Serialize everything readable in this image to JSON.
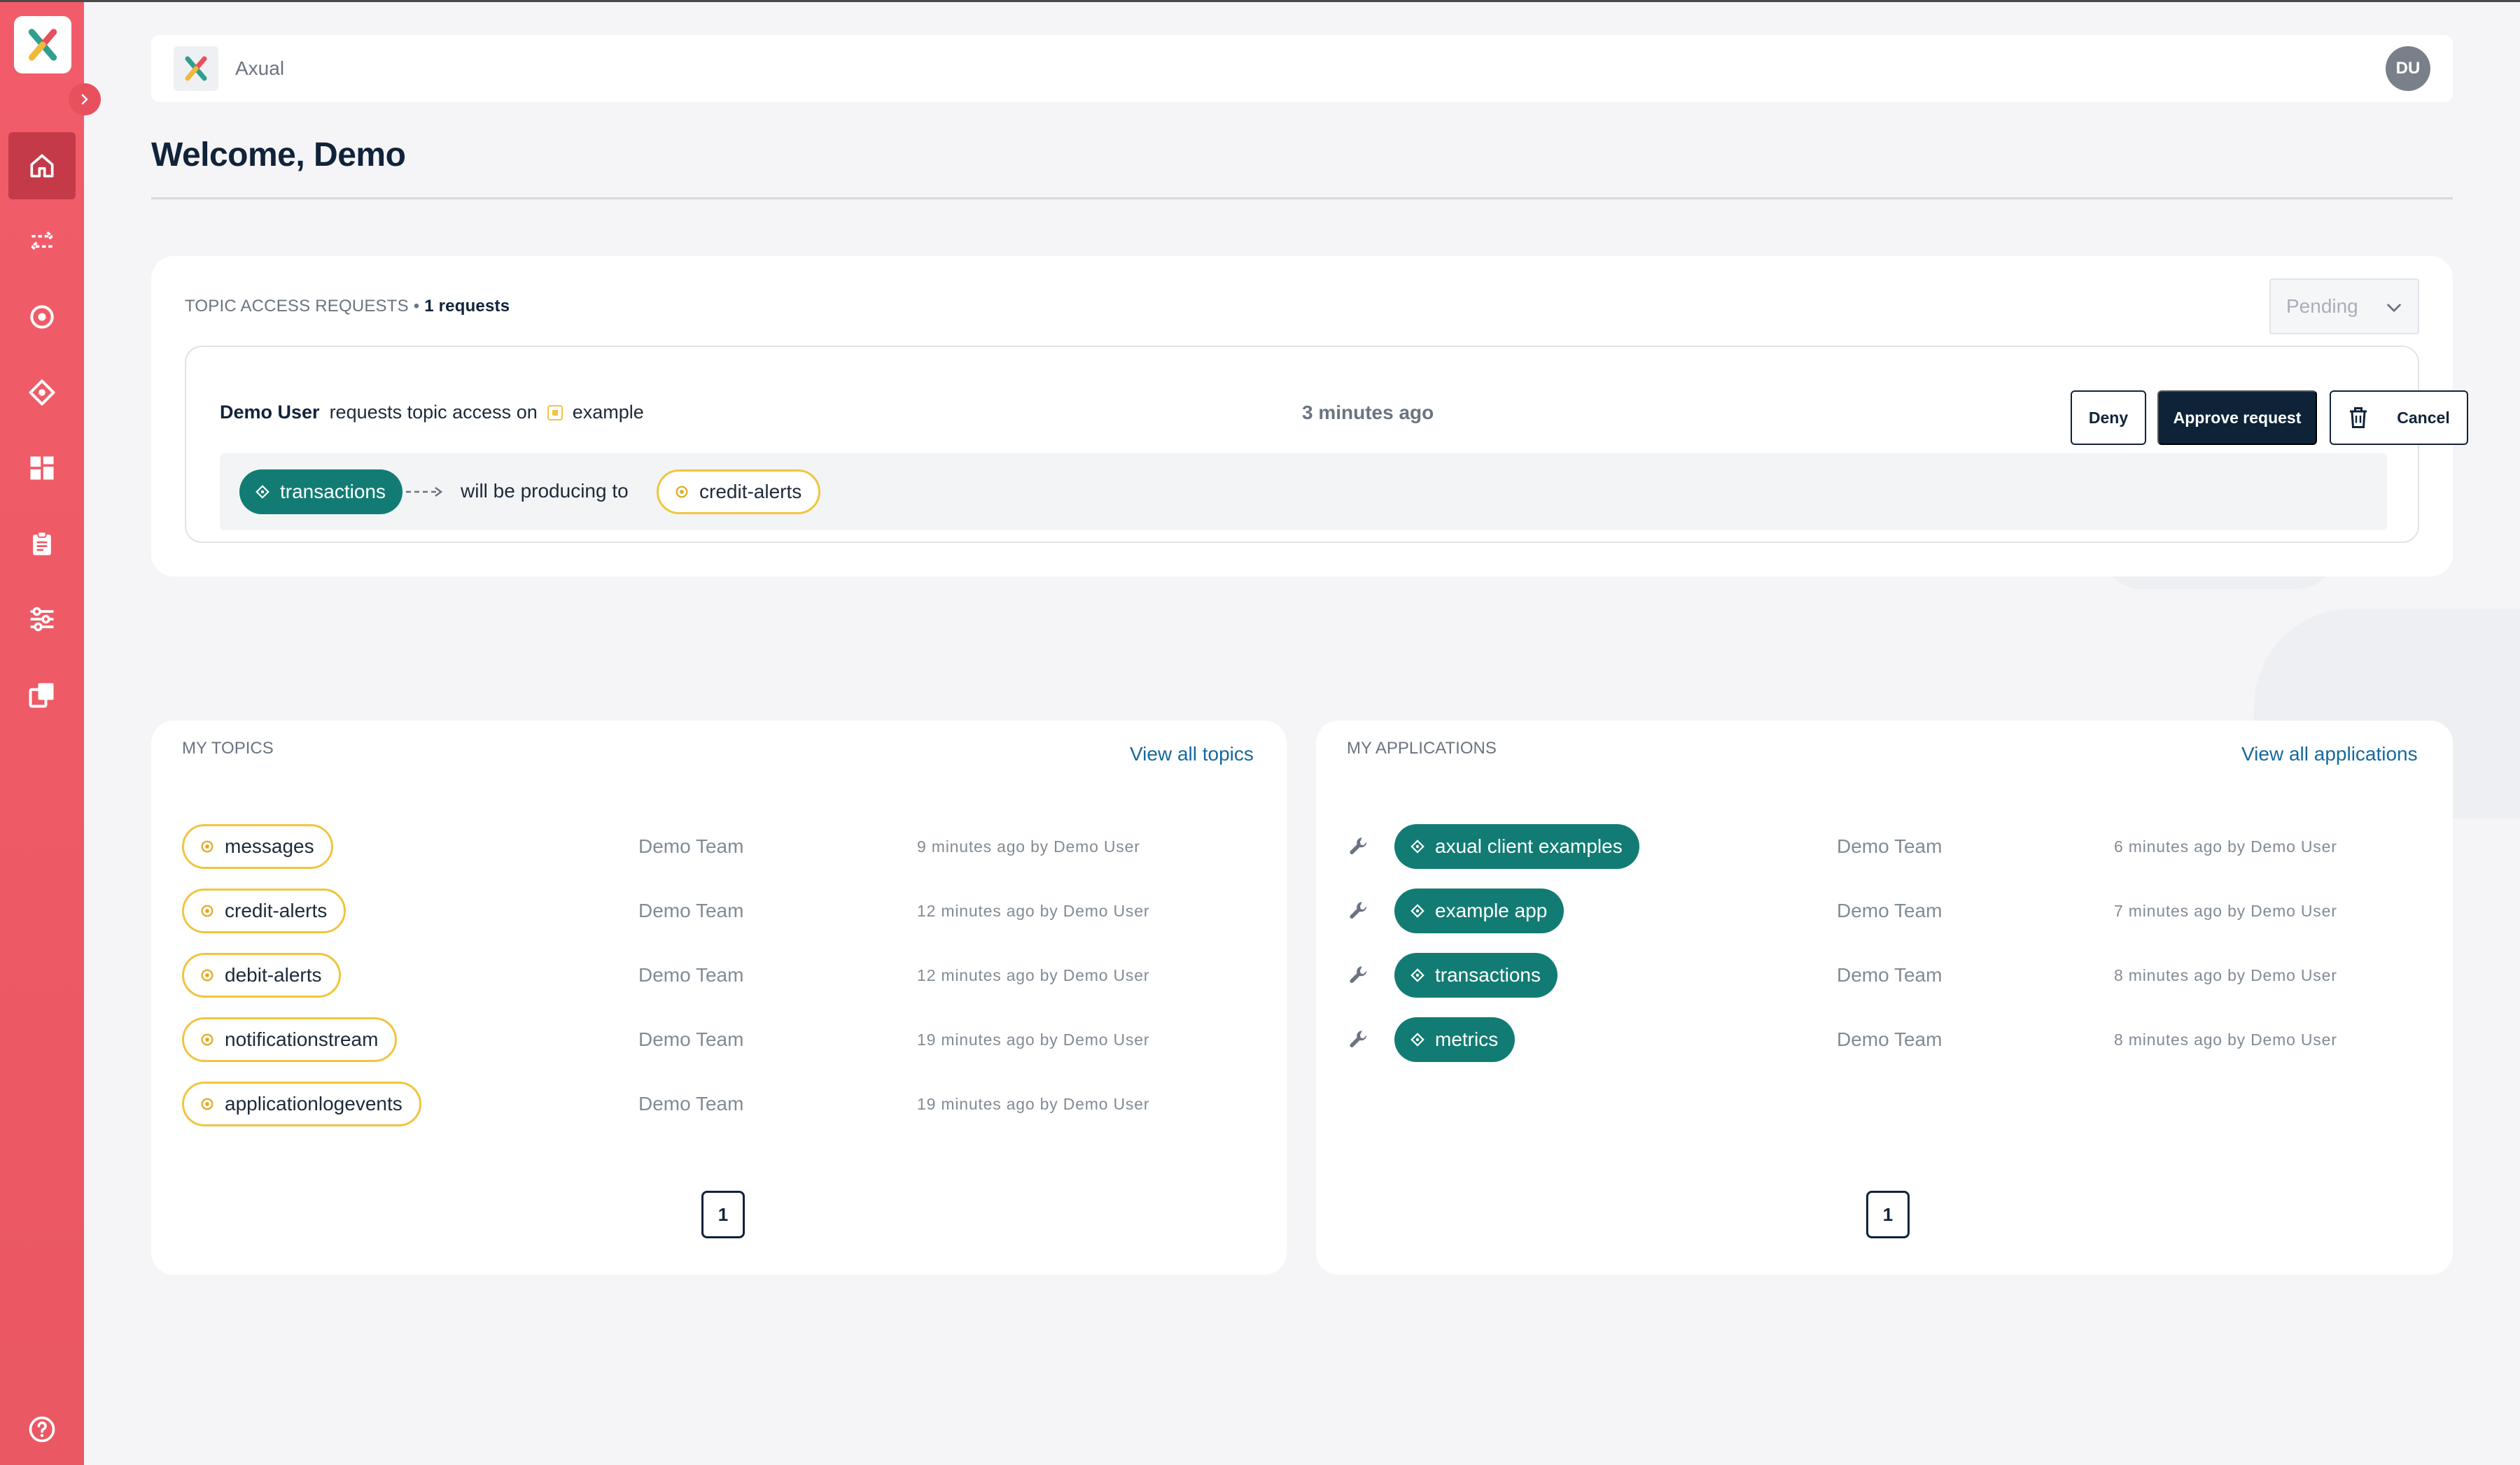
{
  "app": {
    "name": "Axual",
    "user_initials": "DU"
  },
  "sidebar": {
    "items": [
      {
        "icon": "home-icon",
        "active": true
      },
      {
        "icon": "streams-icon"
      },
      {
        "icon": "topic-icon"
      },
      {
        "icon": "application-icon"
      },
      {
        "icon": "dashboard-icon"
      },
      {
        "icon": "clipboard-icon"
      },
      {
        "icon": "settings-sliders-icon"
      },
      {
        "icon": "copy-icon"
      }
    ],
    "help_icon": "help-icon"
  },
  "welcome": "Welcome, Demo",
  "requests": {
    "heading": "TOPIC ACCESS REQUESTS",
    "separator": "•",
    "count": "1 requests",
    "filter_value": "Pending",
    "items": [
      {
        "user": "Demo User",
        "action": "requests topic access on",
        "topic": "example",
        "time": "3 minutes ago",
        "app": "transactions",
        "relation": "will be producing to",
        "target_topic": "credit-alerts",
        "deny_label": "Deny",
        "approve_label": "Approve request",
        "cancel_label": "Cancel"
      }
    ]
  },
  "my_topics": {
    "heading": "MY TOPICS",
    "view_all": "View all topics",
    "rows": [
      {
        "name": "messages",
        "team": "Demo Team",
        "updated": "9 minutes ago by Demo User"
      },
      {
        "name": "credit-alerts",
        "team": "Demo Team",
        "updated": "12 minutes ago by Demo User"
      },
      {
        "name": "debit-alerts",
        "team": "Demo Team",
        "updated": "12 minutes ago by Demo User"
      },
      {
        "name": "notificationstream",
        "team": "Demo Team",
        "updated": "19 minutes ago by Demo User"
      },
      {
        "name": "applicationlogevents",
        "team": "Demo Team",
        "updated": "19 minutes ago by Demo User"
      }
    ],
    "page": "1"
  },
  "my_applications": {
    "heading": "MY APPLICATIONS",
    "view_all": "View all applications",
    "rows": [
      {
        "name": "axual client examples",
        "team": "Demo Team",
        "updated": "6 minutes ago by Demo User"
      },
      {
        "name": "example app",
        "team": "Demo Team",
        "updated": "7 minutes ago by Demo User"
      },
      {
        "name": "transactions",
        "team": "Demo Team",
        "updated": "8 minutes ago by Demo User"
      },
      {
        "name": "metrics",
        "team": "Demo Team",
        "updated": "8 minutes ago by Demo User"
      }
    ],
    "page": "1"
  },
  "colors": {
    "sidebar": "#ee5a66",
    "sidebar_active": "#c43a48",
    "app_pill": "#127c74",
    "topic_border": "#f0c53f",
    "primary_dark": "#0e2338",
    "link": "#17699e"
  }
}
